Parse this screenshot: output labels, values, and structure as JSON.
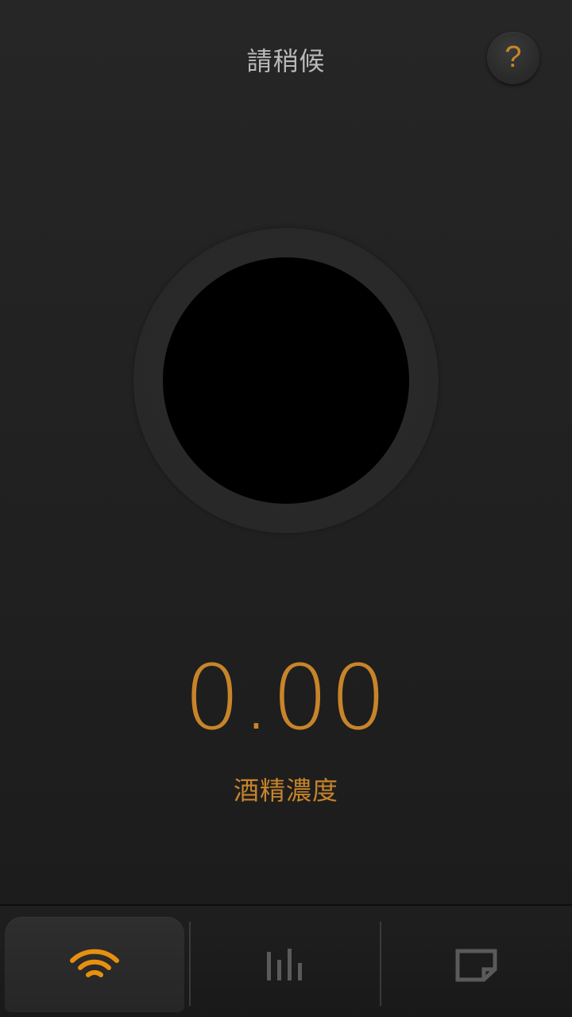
{
  "header": {
    "title": "請稍候",
    "help_label": "?"
  },
  "meter": {
    "value": "0.00",
    "label": "酒精濃度"
  },
  "nav": {
    "tabs": [
      {
        "icon": "wifi-icon",
        "active": true
      },
      {
        "icon": "bar-chart-icon",
        "active": false
      },
      {
        "icon": "note-icon",
        "active": false
      }
    ]
  },
  "colors": {
    "accent": "#c8842a",
    "background": "#222222",
    "ring": "#2a2a2a",
    "core": "#000000",
    "inactive_icon": "#5a5a5a",
    "title_text": "#b9b9b9"
  }
}
